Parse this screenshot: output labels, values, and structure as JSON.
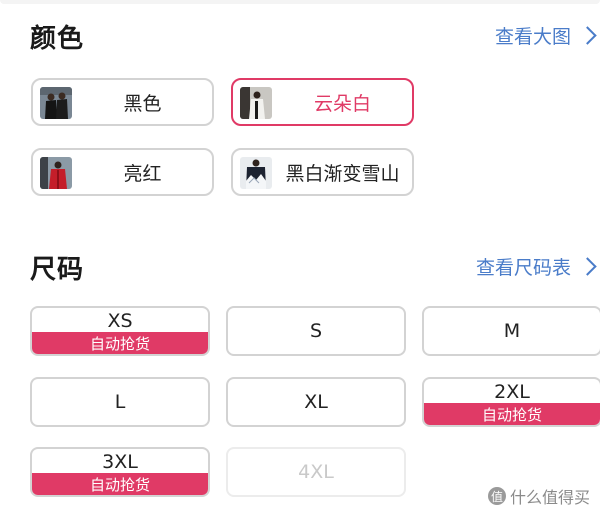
{
  "color_section": {
    "title": "颜色",
    "link_label": "查看大图",
    "options": [
      {
        "label": "黑色",
        "selected": false
      },
      {
        "label": "云朵白",
        "selected": true
      },
      {
        "label": "亮红",
        "selected": false
      },
      {
        "label": "黑白渐变雪山",
        "selected": false
      }
    ]
  },
  "size_section": {
    "title": "尺码",
    "link_label": "查看尺码表",
    "auto_grab_label": "自动抢货",
    "options": [
      {
        "label": "XS",
        "auto_grab": true,
        "disabled": false
      },
      {
        "label": "S",
        "auto_grab": false,
        "disabled": false
      },
      {
        "label": "M",
        "auto_grab": false,
        "disabled": false
      },
      {
        "label": "L",
        "auto_grab": false,
        "disabled": false
      },
      {
        "label": "XL",
        "auto_grab": false,
        "disabled": false
      },
      {
        "label": "2XL",
        "auto_grab": true,
        "disabled": false
      },
      {
        "label": "3XL",
        "auto_grab": true,
        "disabled": false
      },
      {
        "label": "4XL",
        "auto_grab": false,
        "disabled": true
      }
    ]
  },
  "watermark": {
    "badge": "值",
    "text": "什么值得买"
  },
  "colors": {
    "accent": "#e03a66",
    "link": "#4a7cc9",
    "border": "#d3d3d3",
    "disabled_text": "#c9c9c9"
  }
}
